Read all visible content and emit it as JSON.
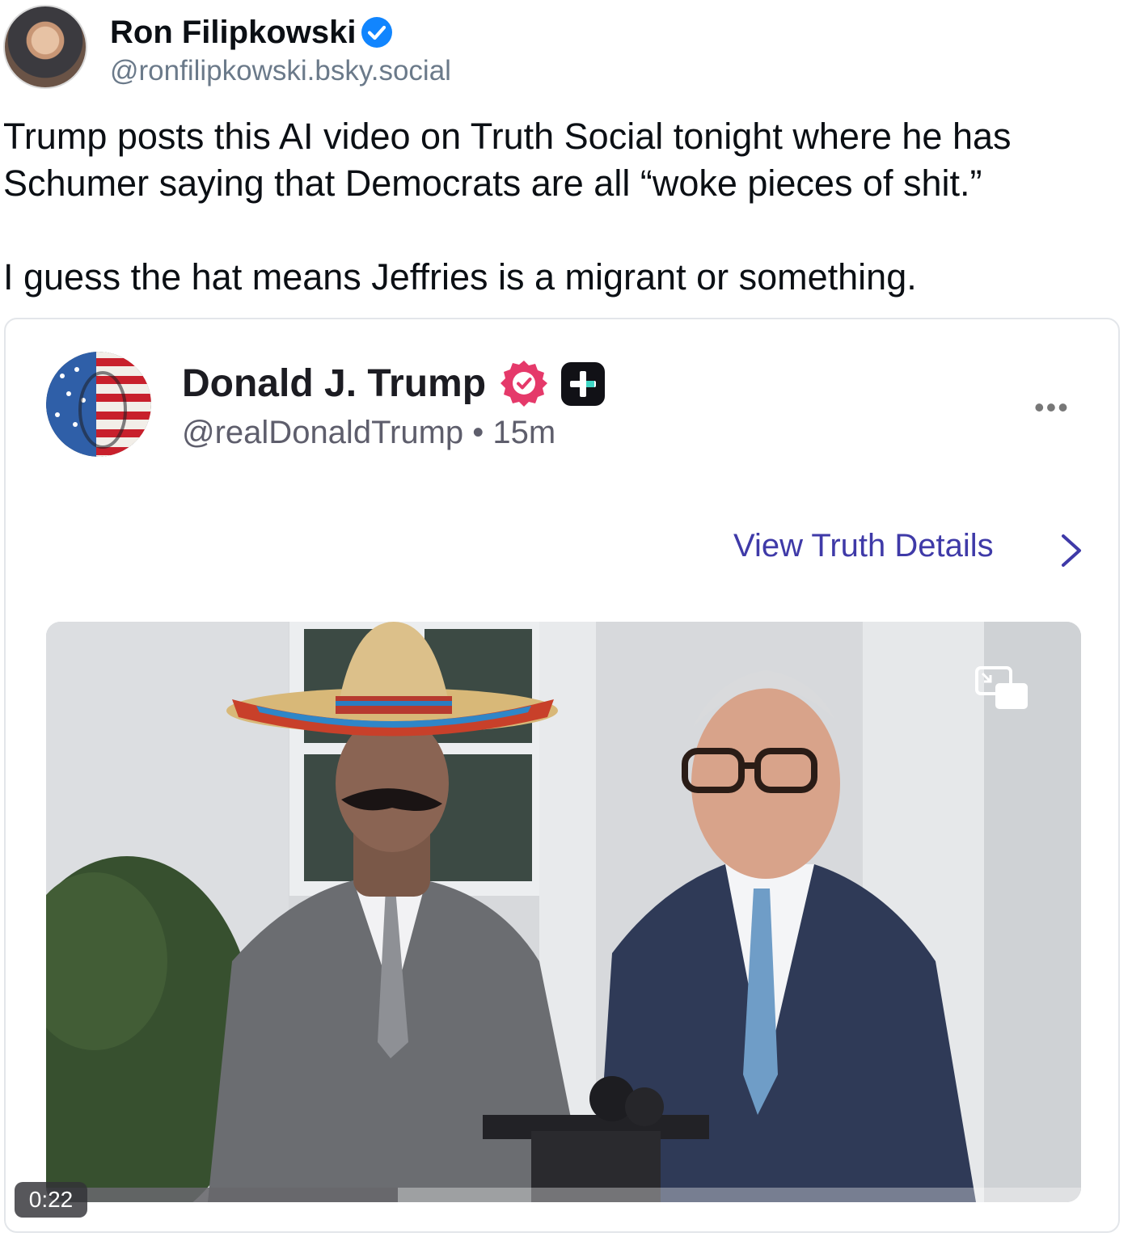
{
  "author": {
    "name": "Ron Filipkowski",
    "handle": "@ronfilipkowski.bsky.social",
    "avatar_icon": "person-avatar",
    "verified_icon": "verified-check-icon"
  },
  "post": {
    "line1": "Trump posts this AI video on Truth Social tonight where he has",
    "line2": "Schumer saying that Democrats are all “woke pieces of shit.”",
    "line3": "I guess the hat means Jeffries is a migrant or something."
  },
  "embed": {
    "name": "Donald J. Trump",
    "handle": "@realDonaldTrump",
    "separator": "•",
    "time": "15m",
    "more_label": "•••",
    "view_details": "View Truth Details",
    "video": {
      "duration": "0:22",
      "progress": 0.34,
      "pip_icon": "picture-in-picture-icon"
    }
  },
  "colors": {
    "link": "#3f3aa8",
    "verified_blue": "#1185fe",
    "truth_badge": "#e5396a",
    "muted": "#6b7a8a"
  }
}
